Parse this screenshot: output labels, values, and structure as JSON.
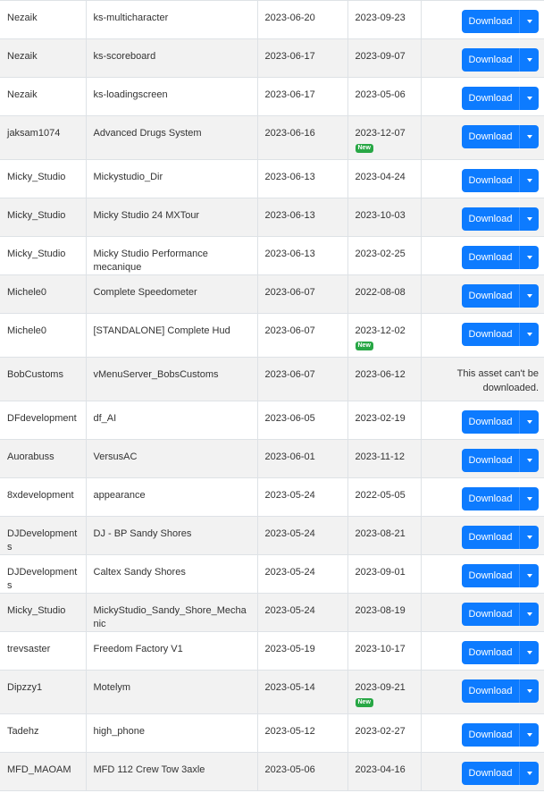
{
  "download_label": "Download",
  "new_label": "New",
  "no_download_text": "This asset can't be downloaded.",
  "rows": [
    {
      "author": "Nezaik",
      "name": "ks-multicharacter",
      "date1": "2023-06-20",
      "date2": "2023-09-23",
      "is_new": false,
      "downloadable": true
    },
    {
      "author": "Nezaik",
      "name": "ks-scoreboard",
      "date1": "2023-06-17",
      "date2": "2023-09-07",
      "is_new": false,
      "downloadable": true
    },
    {
      "author": "Nezaik",
      "name": "ks-loadingscreen",
      "date1": "2023-06-17",
      "date2": "2023-05-06",
      "is_new": false,
      "downloadable": true
    },
    {
      "author": "jaksam1074",
      "name": "Advanced Drugs System",
      "date1": "2023-06-16",
      "date2": "2023-12-07",
      "is_new": true,
      "downloadable": true
    },
    {
      "author": "Micky_Studio",
      "name": "Mickystudio_Dir",
      "date1": "2023-06-13",
      "date2": "2023-04-24",
      "is_new": false,
      "downloadable": true
    },
    {
      "author": "Micky_Studio",
      "name": "Micky Studio 24 MXTour",
      "date1": "2023-06-13",
      "date2": "2023-10-03",
      "is_new": false,
      "downloadable": true
    },
    {
      "author": "Micky_Studio",
      "name": "Micky Studio Performance mecanique",
      "date1": "2023-06-13",
      "date2": "2023-02-25",
      "is_new": false,
      "downloadable": true
    },
    {
      "author": "Michele0",
      "name": "Complete Speedometer",
      "date1": "2023-06-07",
      "date2": "2022-08-08",
      "is_new": false,
      "downloadable": true
    },
    {
      "author": "Michele0",
      "name": "[STANDALONE] Complete Hud",
      "date1": "2023-06-07",
      "date2": "2023-12-02",
      "is_new": true,
      "downloadable": true
    },
    {
      "author": "BobCustoms",
      "name": "vMenuServer_BobsCustoms",
      "date1": "2023-06-07",
      "date2": "2023-06-12",
      "is_new": false,
      "downloadable": false
    },
    {
      "author": "DFdevelopment",
      "name": "df_AI",
      "date1": "2023-06-05",
      "date2": "2023-02-19",
      "is_new": false,
      "downloadable": true
    },
    {
      "author": "Auorabuss",
      "name": "VersusAC",
      "date1": "2023-06-01",
      "date2": "2023-11-12",
      "is_new": false,
      "downloadable": true
    },
    {
      "author": "8xdevelopment",
      "name": "appearance",
      "date1": "2023-05-24",
      "date2": "2022-05-05",
      "is_new": false,
      "downloadable": true
    },
    {
      "author": "DJDevelopments",
      "name": "DJ - BP Sandy Shores",
      "date1": "2023-05-24",
      "date2": "2023-08-21",
      "is_new": false,
      "downloadable": true
    },
    {
      "author": "DJDevelopments",
      "name": "Caltex Sandy Shores",
      "date1": "2023-05-24",
      "date2": "2023-09-01",
      "is_new": false,
      "downloadable": true
    },
    {
      "author": "Micky_Studio",
      "name": "MickyStudio_Sandy_Shore_Mechanic",
      "date1": "2023-05-24",
      "date2": "2023-08-19",
      "is_new": false,
      "downloadable": true
    },
    {
      "author": "trevsaster",
      "name": "Freedom Factory V1",
      "date1": "2023-05-19",
      "date2": "2023-10-17",
      "is_new": false,
      "downloadable": true
    },
    {
      "author": "Dipzzy1",
      "name": "Motelym",
      "date1": "2023-05-14",
      "date2": "2023-09-21",
      "is_new": true,
      "downloadable": true
    },
    {
      "author": "Tadehz",
      "name": "high_phone",
      "date1": "2023-05-12",
      "date2": "2023-02-27",
      "is_new": false,
      "downloadable": true
    },
    {
      "author": "MFD_MAOAM",
      "name": "MFD 112 Crew Tow 3axle",
      "date1": "2023-05-06",
      "date2": "2023-04-16",
      "is_new": false,
      "downloadable": true
    }
  ]
}
